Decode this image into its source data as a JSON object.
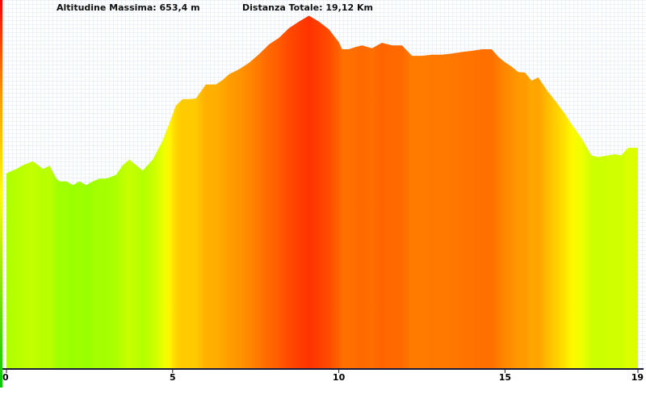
{
  "header": {
    "max_altitude": "Altitudine Massima: 653,4 m",
    "total_distance": "Distanza Totale: 19,12 Km"
  },
  "chart_data": {
    "type": "area",
    "title": "",
    "xlabel": "",
    "ylabel": "",
    "xlim": [
      0,
      19
    ],
    "ylim": [
      0,
      680
    ],
    "x_ticks": [
      "0",
      "5",
      "10",
      "15",
      "19"
    ],
    "colors": {
      "low": "#99ff00",
      "mid": "#ffff00",
      "high": "#ff9900",
      "peak": "#ff3300",
      "grid": "#dde6f3",
      "axis": "#1a1a3a",
      "y_bar_low": "#00cc00",
      "y_bar_high": "#ff0000"
    },
    "series": [
      {
        "x": [
          0,
          0.3,
          0.5,
          0.8,
          1.1,
          1.3,
          1.5,
          1.6,
          1.8,
          2.0,
          2.2,
          2.4,
          2.6,
          2.8,
          3.0,
          3.3,
          3.5,
          3.7,
          3.9,
          4.1,
          4.4,
          4.7,
          4.9,
          5.1,
          5.3,
          5.5,
          5.7,
          6.0,
          6.3,
          6.5,
          6.7,
          7.0,
          7.3,
          7.6,
          7.9,
          8.2,
          8.5,
          8.8,
          9.1,
          9.4,
          9.7,
          10.0,
          10.1,
          10.3,
          10.5,
          10.7,
          11.0,
          11.3,
          11.6,
          11.9,
          12.2,
          12.5,
          12.8,
          13.1,
          13.4,
          13.7,
          14.0,
          14.3,
          14.6,
          14.8,
          15.0,
          15.2,
          15.4,
          15.6,
          15.8,
          16.0,
          16.3,
          16.5,
          16.8,
          17.0,
          17.3,
          17.6,
          17.8,
          18.0,
          18.3,
          18.5,
          18.7,
          19.0
        ],
        "y": [
          360,
          368,
          375,
          382,
          368,
          374,
          350,
          345,
          345,
          338,
          345,
          338,
          345,
          350,
          350,
          357,
          375,
          385,
          375,
          365,
          385,
          420,
          452,
          485,
          497,
          497,
          498,
          524,
          524,
          532,
          543,
          552,
          564,
          580,
          598,
          610,
          628,
          640,
          651,
          640,
          626,
          602,
          589,
          589,
          593,
          596,
          591,
          601,
          596,
          596,
          577,
          577,
          579,
          579,
          581,
          584,
          586,
          589,
          589,
          575,
          565,
          557,
          547,
          546,
          531,
          537,
          510,
          495,
          470,
          451,
          425,
          393,
          390,
          392,
          395,
          393,
          407,
          407
        ]
      }
    ]
  }
}
